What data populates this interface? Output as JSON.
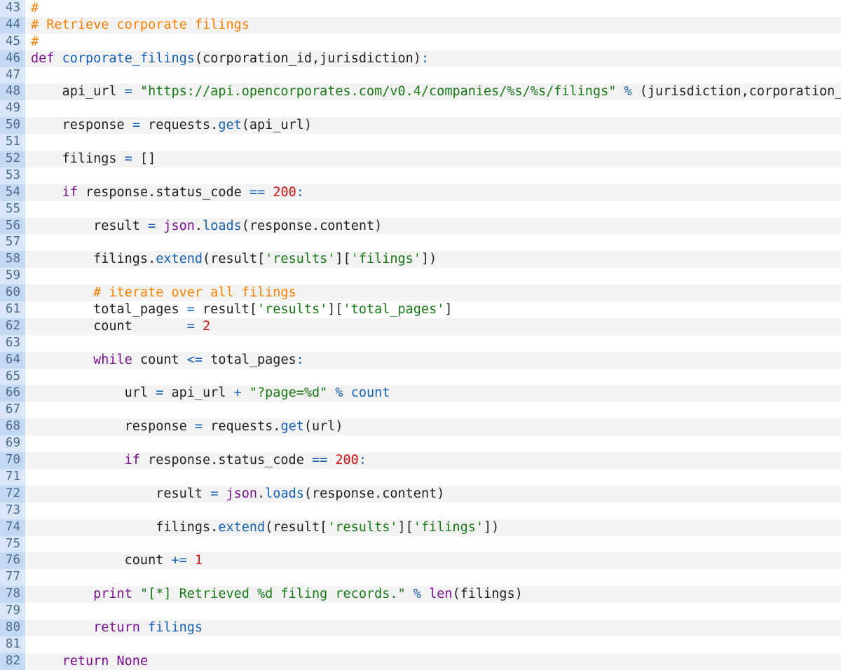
{
  "editor": {
    "colors": {
      "gutter_bg": "#d8e6f7",
      "gutter_alt_bg": "#c3d8f1",
      "gutter_text": "#4b6b92",
      "row_alt_bg": "#f3f3f3",
      "keyword": "#7a0f8f",
      "function": "#1560b8",
      "string": "#167a14",
      "number": "#d01010",
      "comment": "#ff8000",
      "plain": "#222222"
    },
    "lines": [
      {
        "n": "43",
        "t": [
          [
            "com",
            "#"
          ]
        ]
      },
      {
        "n": "44",
        "t": [
          [
            "com",
            "# Retrieve corporate filings"
          ]
        ]
      },
      {
        "n": "45",
        "t": [
          [
            "com",
            "#"
          ]
        ]
      },
      {
        "n": "46",
        "t": [
          [
            "kw",
            "def"
          ],
          [
            "plain",
            " "
          ],
          [
            "fn",
            "corporate_filings"
          ],
          [
            "plain",
            "(corporation_id,jurisdiction)"
          ],
          [
            "op",
            ":"
          ]
        ]
      },
      {
        "n": "47",
        "t": []
      },
      {
        "n": "48",
        "t": [
          [
            "plain",
            "    api_url "
          ],
          [
            "op",
            "="
          ],
          [
            "plain",
            " "
          ],
          [
            "str",
            "\"https://api.opencorporates.com/v0.4/companies/%s/%s/filings\""
          ],
          [
            "plain",
            " "
          ],
          [
            "op",
            "%"
          ],
          [
            "plain",
            " (jurisdiction,corporation_id)"
          ]
        ]
      },
      {
        "n": "49",
        "t": []
      },
      {
        "n": "50",
        "t": [
          [
            "plain",
            "    response "
          ],
          [
            "op",
            "="
          ],
          [
            "plain",
            " requests."
          ],
          [
            "fn",
            "get"
          ],
          [
            "plain",
            "(api_url)"
          ]
        ]
      },
      {
        "n": "51",
        "t": []
      },
      {
        "n": "52",
        "t": [
          [
            "plain",
            "    filings "
          ],
          [
            "op",
            "="
          ],
          [
            "plain",
            " []"
          ]
        ]
      },
      {
        "n": "53",
        "t": []
      },
      {
        "n": "54",
        "t": [
          [
            "plain",
            "    "
          ],
          [
            "kw",
            "if"
          ],
          [
            "plain",
            " response.status_code "
          ],
          [
            "op",
            "=="
          ],
          [
            "plain",
            " "
          ],
          [
            "num",
            "200"
          ],
          [
            "op",
            ":"
          ]
        ]
      },
      {
        "n": "55",
        "t": []
      },
      {
        "n": "56",
        "t": [
          [
            "plain",
            "        result "
          ],
          [
            "op",
            "="
          ],
          [
            "plain",
            " "
          ],
          [
            "kw",
            "json"
          ],
          [
            "plain",
            "."
          ],
          [
            "fn",
            "loads"
          ],
          [
            "plain",
            "(response.content)"
          ]
        ]
      },
      {
        "n": "57",
        "t": []
      },
      {
        "n": "58",
        "t": [
          [
            "plain",
            "        filings."
          ],
          [
            "fn",
            "extend"
          ],
          [
            "plain",
            "(result["
          ],
          [
            "str",
            "'results'"
          ],
          [
            "plain",
            "]["
          ],
          [
            "str",
            "'filings'"
          ],
          [
            "plain",
            "])"
          ]
        ]
      },
      {
        "n": "59",
        "t": []
      },
      {
        "n": "60",
        "t": [
          [
            "plain",
            "        "
          ],
          [
            "com",
            "# iterate over all filings"
          ]
        ]
      },
      {
        "n": "61",
        "t": [
          [
            "plain",
            "        total_pages "
          ],
          [
            "op",
            "="
          ],
          [
            "plain",
            " result["
          ],
          [
            "str",
            "'results'"
          ],
          [
            "plain",
            "]["
          ],
          [
            "str",
            "'total_pages'"
          ],
          [
            "plain",
            "]"
          ]
        ]
      },
      {
        "n": "62",
        "t": [
          [
            "plain",
            "        count       "
          ],
          [
            "op",
            "="
          ],
          [
            "plain",
            " "
          ],
          [
            "num",
            "2"
          ]
        ]
      },
      {
        "n": "63",
        "t": []
      },
      {
        "n": "64",
        "t": [
          [
            "plain",
            "        "
          ],
          [
            "kw",
            "while"
          ],
          [
            "plain",
            " count "
          ],
          [
            "op",
            "<="
          ],
          [
            "plain",
            " total_pages"
          ],
          [
            "op",
            ":"
          ]
        ]
      },
      {
        "n": "65",
        "t": []
      },
      {
        "n": "66",
        "t": [
          [
            "plain",
            "            url "
          ],
          [
            "op",
            "="
          ],
          [
            "plain",
            " api_url "
          ],
          [
            "op",
            "+"
          ],
          [
            "plain",
            " "
          ],
          [
            "str",
            "\"?page=%d\""
          ],
          [
            "plain",
            " "
          ],
          [
            "op",
            "%"
          ],
          [
            "plain",
            " "
          ],
          [
            "fn",
            "count"
          ]
        ]
      },
      {
        "n": "67",
        "t": []
      },
      {
        "n": "68",
        "t": [
          [
            "plain",
            "            response "
          ],
          [
            "op",
            "="
          ],
          [
            "plain",
            " requests."
          ],
          [
            "fn",
            "get"
          ],
          [
            "plain",
            "(url)"
          ]
        ]
      },
      {
        "n": "69",
        "t": []
      },
      {
        "n": "70",
        "t": [
          [
            "plain",
            "            "
          ],
          [
            "kw",
            "if"
          ],
          [
            "plain",
            " response.status_code "
          ],
          [
            "op",
            "=="
          ],
          [
            "plain",
            " "
          ],
          [
            "num",
            "200"
          ],
          [
            "op",
            ":"
          ]
        ]
      },
      {
        "n": "71",
        "t": []
      },
      {
        "n": "72",
        "t": [
          [
            "plain",
            "                result "
          ],
          [
            "op",
            "="
          ],
          [
            "plain",
            " "
          ],
          [
            "kw",
            "json"
          ],
          [
            "plain",
            "."
          ],
          [
            "fn",
            "loads"
          ],
          [
            "plain",
            "(response.content)"
          ]
        ]
      },
      {
        "n": "73",
        "t": []
      },
      {
        "n": "74",
        "t": [
          [
            "plain",
            "                filings."
          ],
          [
            "fn",
            "extend"
          ],
          [
            "plain",
            "(result["
          ],
          [
            "str",
            "'results'"
          ],
          [
            "plain",
            "]["
          ],
          [
            "str",
            "'filings'"
          ],
          [
            "plain",
            "])"
          ]
        ]
      },
      {
        "n": "75",
        "t": []
      },
      {
        "n": "76",
        "t": [
          [
            "plain",
            "            count "
          ],
          [
            "op",
            "+="
          ],
          [
            "plain",
            " "
          ],
          [
            "num",
            "1"
          ]
        ]
      },
      {
        "n": "77",
        "t": []
      },
      {
        "n": "78",
        "t": [
          [
            "plain",
            "        "
          ],
          [
            "kw",
            "print"
          ],
          [
            "plain",
            " "
          ],
          [
            "str",
            "\"[*] Retrieved %d filing records.\""
          ],
          [
            "plain",
            " "
          ],
          [
            "op",
            "%"
          ],
          [
            "plain",
            " "
          ],
          [
            "kw",
            "len"
          ],
          [
            "plain",
            "(filings)"
          ]
        ]
      },
      {
        "n": "79",
        "t": []
      },
      {
        "n": "80",
        "t": [
          [
            "plain",
            "        "
          ],
          [
            "kw",
            "return"
          ],
          [
            "plain",
            " "
          ],
          [
            "fn",
            "filings"
          ]
        ]
      },
      {
        "n": "81",
        "t": []
      },
      {
        "n": "82",
        "t": [
          [
            "plain",
            "    "
          ],
          [
            "kw",
            "return"
          ],
          [
            "plain",
            " "
          ],
          [
            "kw",
            "None"
          ]
        ]
      }
    ]
  }
}
